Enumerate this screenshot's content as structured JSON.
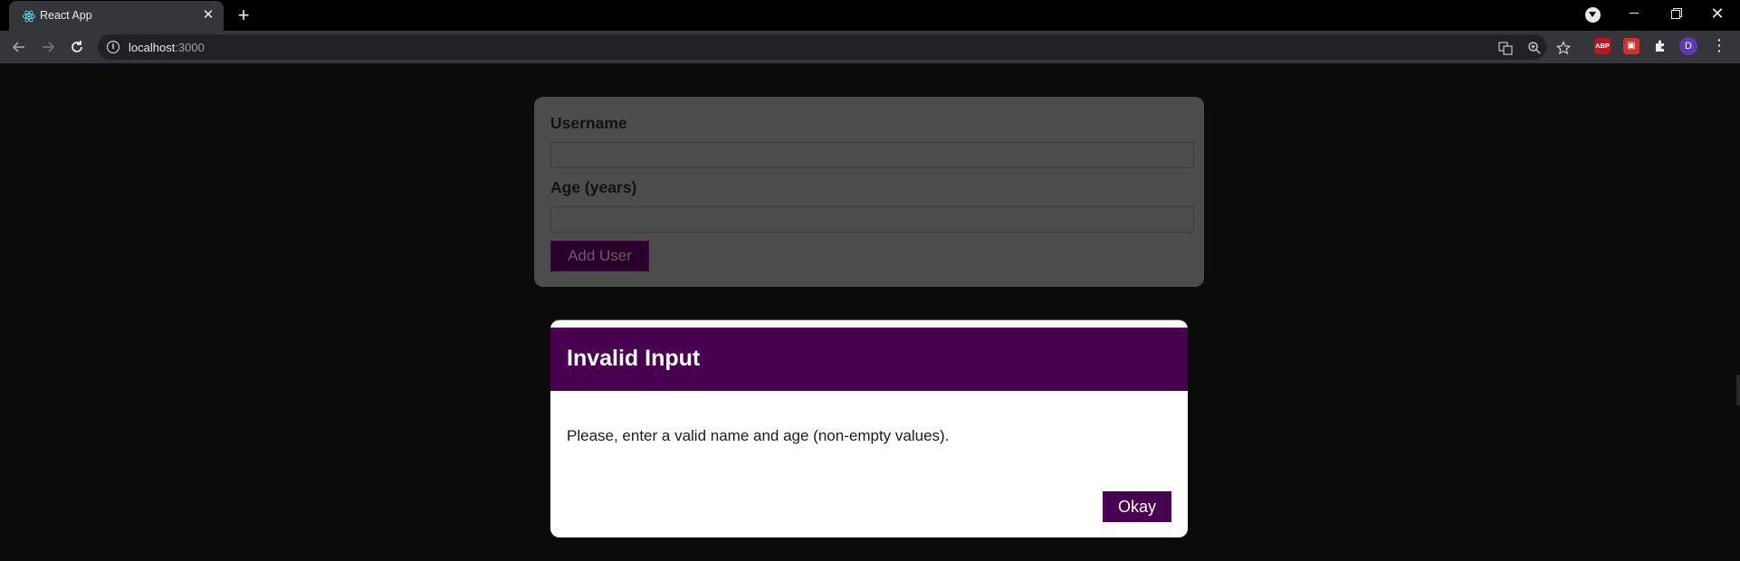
{
  "browser": {
    "tab_title": "React App",
    "tab_close_symbol": "✕",
    "new_tab_symbol": "+",
    "url_host": "localhost",
    "url_port": ":3000",
    "window_close_symbol": "✕",
    "avatar_initial": "D",
    "extension_abp_label": "ABP"
  },
  "form": {
    "username_label": "Username",
    "username_value": "",
    "age_label": "Age (years)",
    "age_value": "",
    "add_button_label": "Add User"
  },
  "modal": {
    "title": "Invalid Input",
    "message": "Please, enter a valid name and age (non-empty values).",
    "okay_label": "Okay"
  },
  "colors": {
    "modal_accent": "#4a0050",
    "page_background": "#0b0b0b",
    "form_card": "#4c4c4c"
  },
  "icons": {
    "tab_favicon": "react-logo-icon",
    "back": "arrow-left-icon",
    "forward": "arrow-right-icon",
    "reload": "reload-icon",
    "site_info": "info-icon",
    "translate": "translate-icon",
    "zoom": "zoom-icon",
    "bookmark": "star-icon",
    "extensions": "puzzle-icon",
    "menu": "kebab-menu-icon"
  }
}
